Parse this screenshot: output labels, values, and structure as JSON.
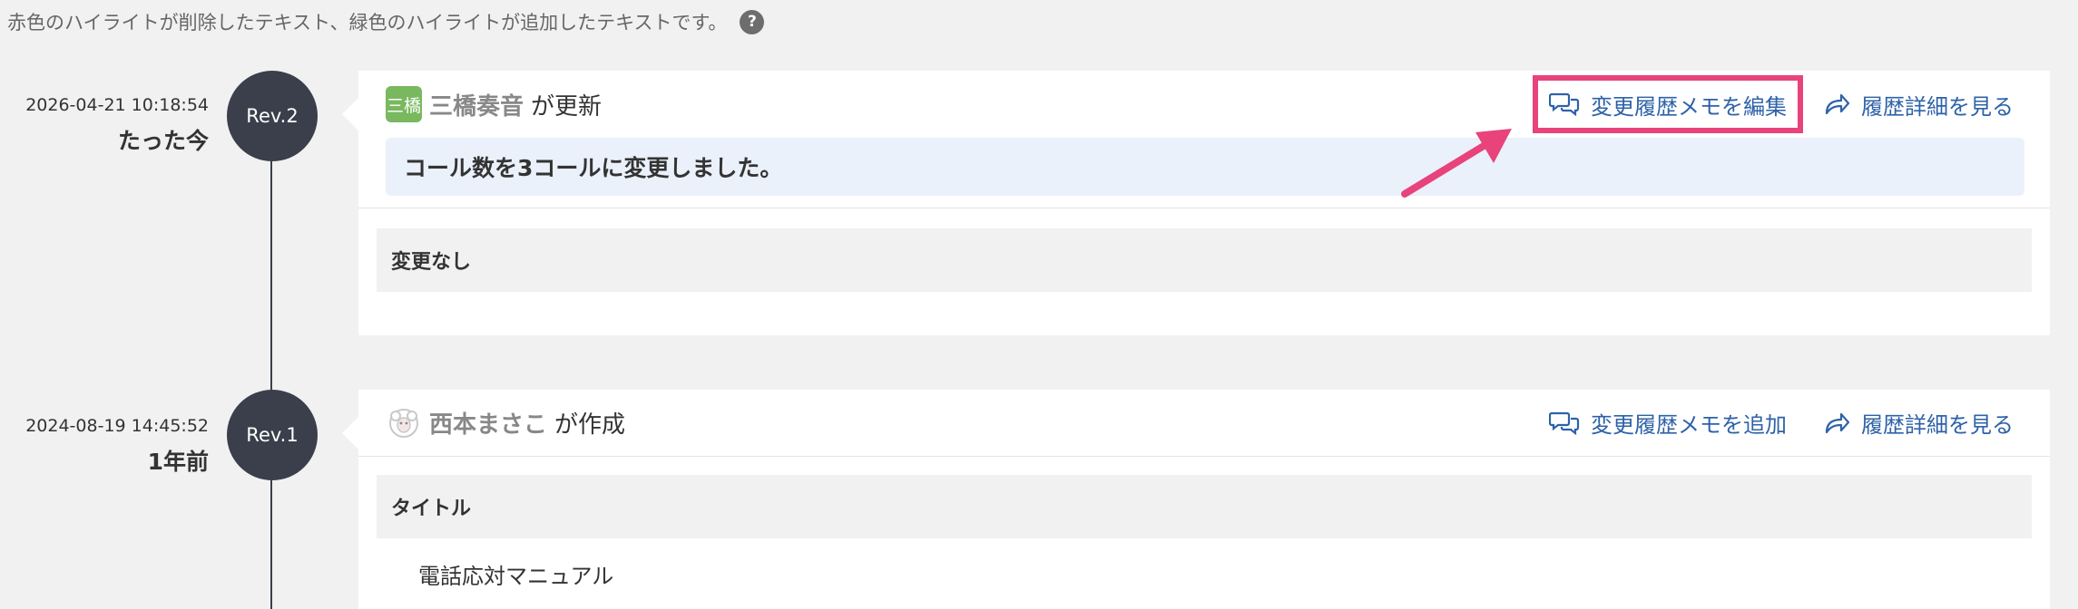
{
  "notice": {
    "text": "赤色のハイライトが削除したテキスト、緑色のハイライトが追加したテキストです。",
    "help_icon": "?"
  },
  "revisions": [
    {
      "date": "2026-04-21 10:18:54",
      "ago": "たった今",
      "rev_label": "Rev.2",
      "avatar_text": "三橋",
      "user": "三橋奏音",
      "action": "が更新",
      "memo_link": "変更履歴メモを編集",
      "detail_link": "履歴詳細を見る",
      "memo": "コール数を3コールに変更しました。",
      "section_title": "変更なし"
    },
    {
      "date": "2024-08-19 14:45:52",
      "ago": "1年前",
      "rev_label": "Rev.1",
      "avatar_icon": "sheep-avatar-icon",
      "user": "西本まさこ",
      "action": "が作成",
      "memo_link": "変更履歴メモを追加",
      "detail_link": "履歴詳細を見る",
      "section_title": "タイトル",
      "section_value": "電話応対マニュアル"
    }
  ],
  "colors": {
    "link": "#2e62a8",
    "highlight": "#e8437a",
    "timeline": "#3a3f4b",
    "memo_bg": "#eaf1fb"
  }
}
